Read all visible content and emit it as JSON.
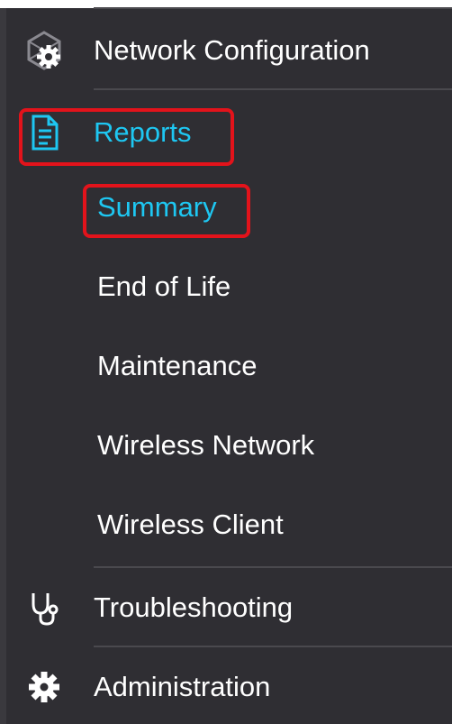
{
  "nav": {
    "network_configuration": {
      "label": "Network Configuration",
      "icon": "network-gear-icon"
    },
    "reports": {
      "label": "Reports",
      "icon": "report-document-icon",
      "children": [
        {
          "label": "Summary"
        },
        {
          "label": "End of Life"
        },
        {
          "label": "Maintenance"
        },
        {
          "label": "Wireless Network"
        },
        {
          "label": "Wireless Client"
        }
      ]
    },
    "troubleshooting": {
      "label": "Troubleshooting",
      "icon": "stethoscope-icon"
    },
    "administration": {
      "label": "Administration",
      "icon": "gear-icon"
    }
  },
  "colors": {
    "background": "#2f2e33",
    "text": "#ffffff",
    "active": "#1ec7f2",
    "highlight": "#e3131b"
  }
}
